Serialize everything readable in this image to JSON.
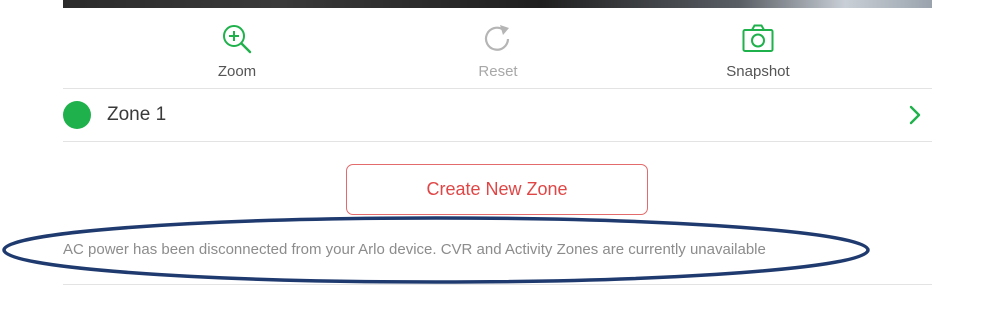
{
  "toolbar": {
    "zoom": {
      "label": "Zoom",
      "icon": "zoom-in-icon",
      "enabled": true
    },
    "reset": {
      "label": "Reset",
      "icon": "refresh-icon",
      "enabled": false
    },
    "snapshot": {
      "label": "Snapshot",
      "icon": "camera-icon",
      "enabled": true
    }
  },
  "zones": [
    {
      "label": "Zone 1",
      "color": "#1fb14b",
      "icon": "chevron-right-icon"
    }
  ],
  "create_zone": {
    "label": "Create New Zone"
  },
  "notice": {
    "text": "AC power has been disconnected from your Arlo device. CVR and Activity Zones are currently unavailable",
    "highlight_color": "#1f3a6e"
  },
  "colors": {
    "accent_green": "#1fb14b",
    "button_red": "#e04646",
    "disabled_gray": "#a8a8a8"
  }
}
